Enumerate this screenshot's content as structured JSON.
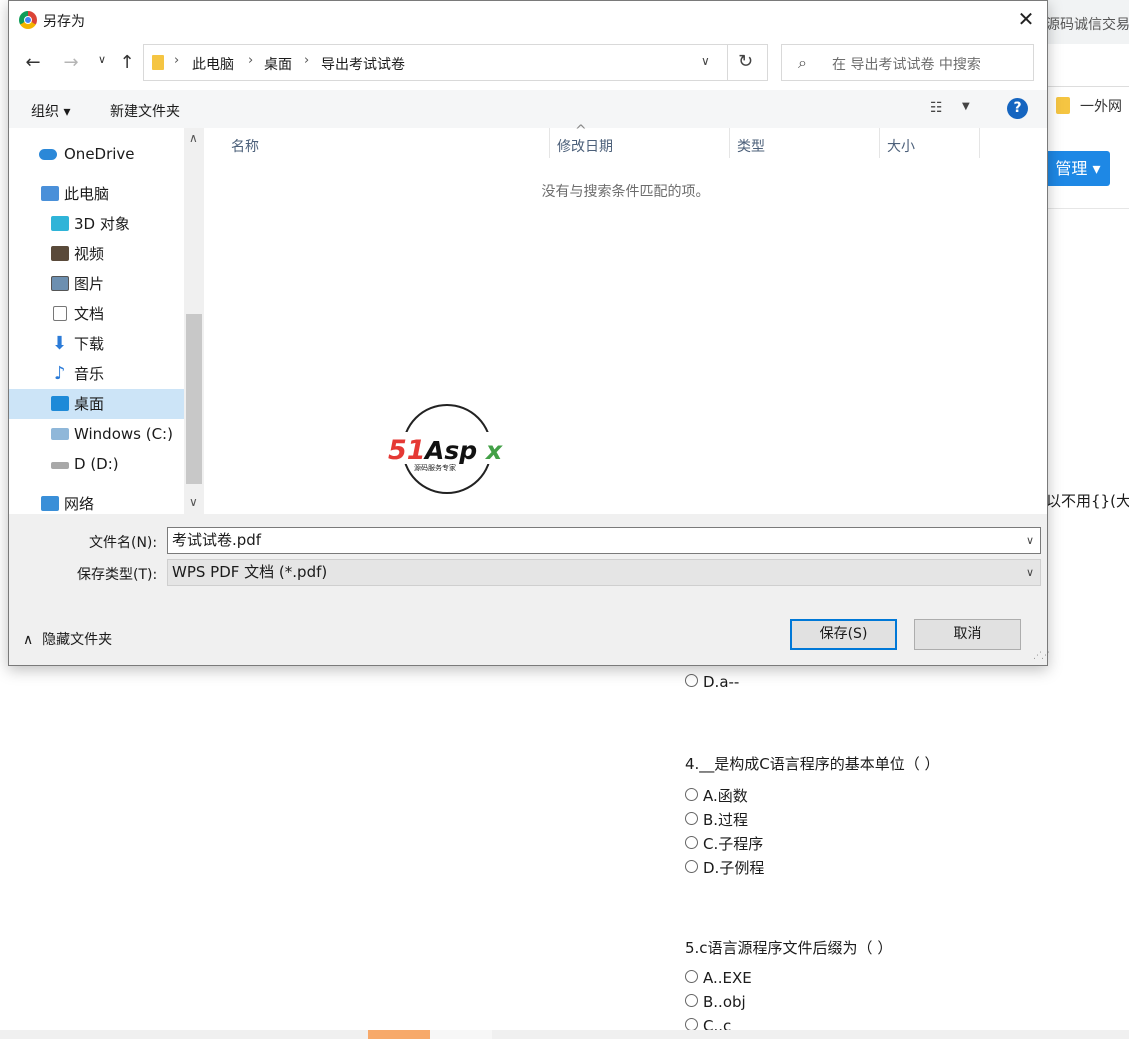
{
  "background": {
    "top_text": "源码诚信交易",
    "bookmark_label": "一外网",
    "manage_button": "管理",
    "side_text": "以不用{}(大括",
    "option_d_prev": "D.a--",
    "questions": [
      {
        "title": "4.__是构成C语言程序的基本单位（ ）",
        "options": [
          "A.函数",
          "B.过程",
          "C.子程序",
          "D.子例程"
        ]
      },
      {
        "title": "5.c语言源程序文件后缀为（ ）",
        "options": [
          "A..EXE",
          "B..obj",
          "C..c"
        ]
      }
    ]
  },
  "dialog": {
    "title": "另存为",
    "breadcrumb": [
      "此电脑",
      "桌面",
      "导出考试试卷"
    ],
    "search_placeholder": "在 导出考试试卷 中搜索",
    "toolbar": {
      "organize": "组织 ▾",
      "new_folder": "新建文件夹"
    },
    "nav_items": [
      {
        "label": "OneDrive",
        "icon": "cloud-icon"
      },
      {
        "label": "此电脑",
        "icon": "computer-icon"
      },
      {
        "label": "3D 对象",
        "icon": "cube-icon"
      },
      {
        "label": "视频",
        "icon": "video-icon"
      },
      {
        "label": "图片",
        "icon": "picture-icon"
      },
      {
        "label": "文档",
        "icon": "document-icon"
      },
      {
        "label": "下载",
        "icon": "download-icon"
      },
      {
        "label": "音乐",
        "icon": "music-icon"
      },
      {
        "label": "桌面",
        "icon": "desktop-icon"
      },
      {
        "label": "Windows  (C:)",
        "icon": "drive-icon"
      },
      {
        "label": "D (D:)",
        "icon": "drive-icon"
      },
      {
        "label": "网络",
        "icon": "network-icon"
      }
    ],
    "columns": [
      "名称",
      "修改日期",
      "类型",
      "大小"
    ],
    "empty_message": "没有与搜索条件匹配的项。",
    "watermark": {
      "brand": "51Aspx",
      "tagline": "源码服务专家"
    },
    "file_name_label": "文件名(N):",
    "file_name_value": "考试试卷.pdf",
    "file_type_label": "保存类型(T):",
    "file_type_value": "WPS PDF 文档 (*.pdf)",
    "hide_folders": "隐藏文件夹",
    "save_button": "保存(S)",
    "cancel_button": "取消"
  }
}
